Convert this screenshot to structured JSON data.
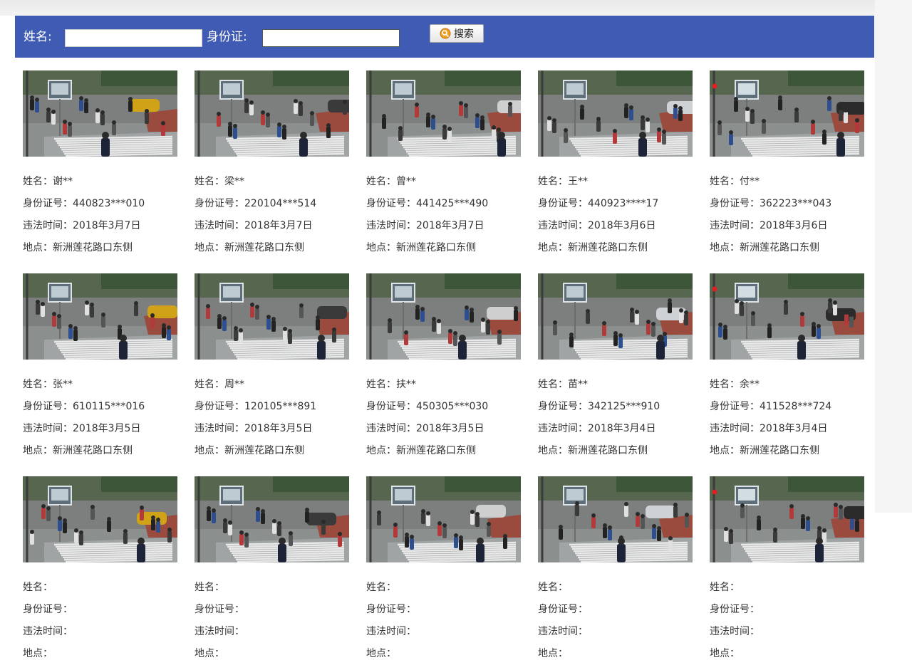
{
  "search": {
    "name_label": "姓名:",
    "name_value": "",
    "id_label": "身份证:",
    "id_value": "",
    "button_label": "搜索"
  },
  "labels": {
    "name": "姓名：",
    "id": "身份证号：",
    "time": "违法时间：",
    "place": "地点："
  },
  "colors": {
    "header_bg": "#3f5bb3"
  },
  "records": [
    {
      "name": "谢**",
      "id": "440823***010",
      "time": "2018年3月7日",
      "place": "新洲莲花路口东侧"
    },
    {
      "name": "梁**",
      "id": "220104***514",
      "time": "2018年3月7日",
      "place": "新洲莲花路口东侧"
    },
    {
      "name": "曾**",
      "id": "441425***490",
      "time": "2018年3月7日",
      "place": "新洲莲花路口东侧"
    },
    {
      "name": "王**",
      "id": "440923****17",
      "time": "2018年3月6日",
      "place": "新洲莲花路口东侧"
    },
    {
      "name": "付**",
      "id": "362223***043",
      "time": "2018年3月6日",
      "place": "新洲莲花路口东侧"
    },
    {
      "name": "张**",
      "id": "610115***016",
      "time": "2018年3月5日",
      "place": "新洲莲花路口东侧"
    },
    {
      "name": "周**",
      "id": "120105***891",
      "time": "2018年3月5日",
      "place": "新洲莲花路口东侧"
    },
    {
      "name": "扶**",
      "id": "450305***030",
      "time": "2018年3月5日",
      "place": "新洲莲花路口东侧"
    },
    {
      "name": "苗**",
      "id": "342125***910",
      "time": "2018年3月4日",
      "place": "新洲莲花路口东侧"
    },
    {
      "name": "余**",
      "id": "411528***724",
      "time": "2018年3月4日",
      "place": "新洲莲花路口东侧"
    },
    {
      "name": "",
      "id": "",
      "time": "",
      "place": ""
    },
    {
      "name": "",
      "id": "",
      "time": "",
      "place": ""
    },
    {
      "name": "",
      "id": "",
      "time": "",
      "place": ""
    },
    {
      "name": "",
      "id": "",
      "time": "",
      "place": ""
    },
    {
      "name": "",
      "id": "",
      "time": "",
      "place": ""
    }
  ]
}
